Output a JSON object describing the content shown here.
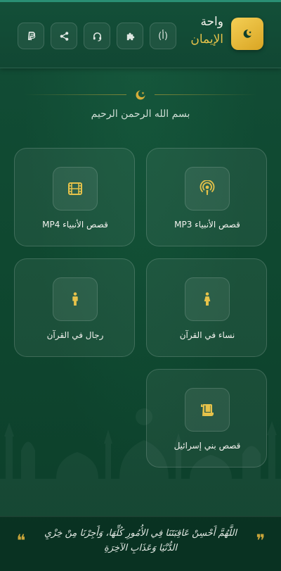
{
  "app": {
    "title_line1": "واحة",
    "title_line2": "الإيمان",
    "logo_icon": "crescent-moon-icon",
    "accent_color": "#e6c24a",
    "background_color": "#0f4a33"
  },
  "toolbar": {
    "buttons": [
      {
        "icon": "paypal-icon"
      },
      {
        "icon": "share-icon"
      },
      {
        "icon": "headset-icon"
      },
      {
        "icon": "puzzle-icon"
      },
      {
        "icon": "language-icon",
        "glyph": "(أ)"
      }
    ]
  },
  "header_ornament": {
    "icon": "crescent-star-icon",
    "text": "بسم الله الرحمن الرحيم"
  },
  "cards": [
    {
      "label": "قصص الأنبياء MP3",
      "icon": "podcast-icon"
    },
    {
      "label": "قصص الأنبياء MP4",
      "icon": "film-icon"
    },
    {
      "label": "نساء في القرآن",
      "icon": "female-icon"
    },
    {
      "label": "رجال في القرآن",
      "icon": "male-icon"
    },
    {
      "label": "قصص بني إسرائيل",
      "icon": "scroll-icon"
    }
  ],
  "footer": {
    "quote": "اللَّهُمَّ أَحْسِنْ عَاقِبَتَنَا فِي الأُمُورِ كُلِّهَا، وَأَجِرْنَا مِنْ خِزْيِ الدُّنْيَا وَعَذَابِ الآخِرَةِ",
    "open_mark": "❞",
    "close_mark": "❝"
  }
}
